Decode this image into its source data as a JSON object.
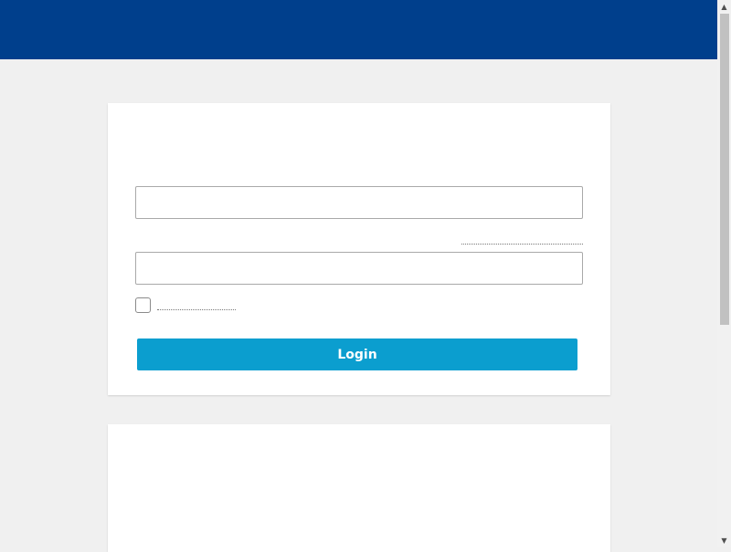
{
  "header": {
    "color": "#003f8c"
  },
  "login_form": {
    "username_value": "",
    "password_value": "",
    "remember_checked": false,
    "login_label": "Login",
    "button_color": "#0b9ecf"
  },
  "scrollbar": {
    "up_icon": "scroll-up-arrow",
    "down_icon": "scroll-down-arrow",
    "up_glyph": "▲",
    "down_glyph": "▼"
  }
}
